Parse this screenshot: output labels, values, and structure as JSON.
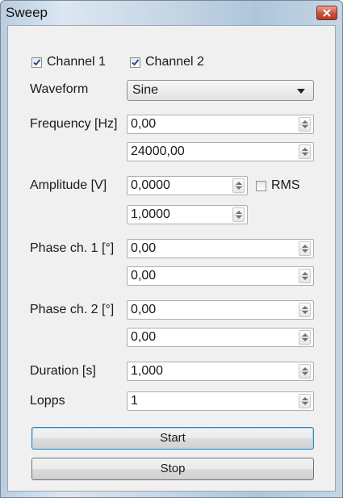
{
  "window": {
    "title": "Sweep"
  },
  "channels": {
    "ch1": "Channel 1",
    "ch1_checked": true,
    "ch2": "Channel 2",
    "ch2_checked": true
  },
  "labels": {
    "waveform": "Waveform",
    "frequency": "Frequency [Hz]",
    "amplitude": "Amplitude [V]",
    "phase1": "Phase ch. 1 [°]",
    "phase2": "Phase ch. 2 [°]",
    "duration": "Duration [s]",
    "loops": "Lopps"
  },
  "waveform": {
    "selected": "Sine"
  },
  "fields": {
    "frequency_start": "0,00",
    "frequency_end": "24000,00",
    "amplitude_start": "0,0000",
    "amplitude_end": "1,0000",
    "phase1_start": "0,00",
    "phase1_end": "0,00",
    "phase2_start": "0,00",
    "phase2_end": "0,00",
    "duration": "1,000",
    "loops": "1"
  },
  "rms": {
    "label": "RMS",
    "checked": false
  },
  "buttons": {
    "start": "Start",
    "stop": "Stop"
  }
}
